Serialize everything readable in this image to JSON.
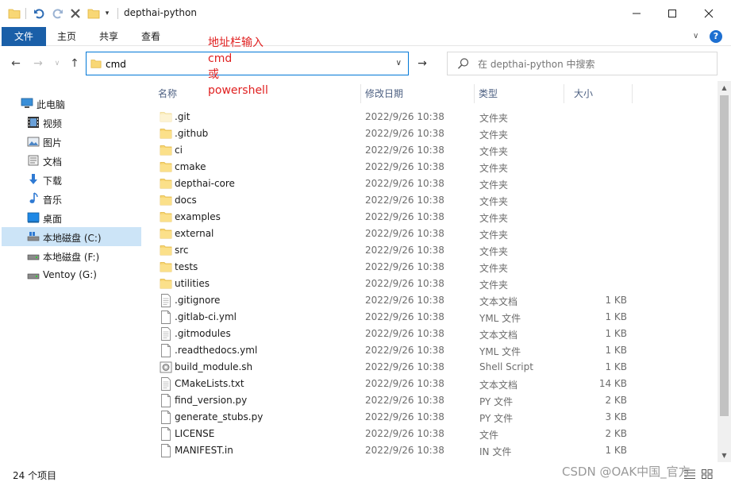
{
  "window": {
    "title": "depthai-python"
  },
  "ribbon": {
    "tabs": [
      "文件",
      "主页",
      "共享",
      "查看"
    ]
  },
  "address": {
    "value": "cmd"
  },
  "search": {
    "placeholder": "在 depthai-python 中搜索"
  },
  "annotation": {
    "lines": [
      "地址栏输入",
      "cmd",
      "或",
      "powershell"
    ]
  },
  "sidebar": {
    "items": [
      {
        "label": "此电脑",
        "icon": "computer-icon"
      },
      {
        "label": "视频",
        "icon": "video-icon"
      },
      {
        "label": "图片",
        "icon": "pictures-icon"
      },
      {
        "label": "文档",
        "icon": "documents-icon"
      },
      {
        "label": "下载",
        "icon": "download-icon"
      },
      {
        "label": "音乐",
        "icon": "music-icon"
      },
      {
        "label": "桌面",
        "icon": "desktop-icon"
      },
      {
        "label": "本地磁盘 (C:)",
        "icon": "drive-icon",
        "selected": true
      },
      {
        "label": "本地磁盘 (F:)",
        "icon": "drive-icon"
      },
      {
        "label": "Ventoy (G:)",
        "icon": "drive-icon"
      }
    ]
  },
  "columns": {
    "name": "名称",
    "date": "修改日期",
    "type": "类型",
    "size": "大小"
  },
  "files": [
    {
      "name": ".git",
      "date": "2022/9/26 10:38",
      "type": "文件夹",
      "size": "",
      "kind": "folder-faded"
    },
    {
      "name": ".github",
      "date": "2022/9/26 10:38",
      "type": "文件夹",
      "size": "",
      "kind": "folder"
    },
    {
      "name": "ci",
      "date": "2022/9/26 10:38",
      "type": "文件夹",
      "size": "",
      "kind": "folder"
    },
    {
      "name": "cmake",
      "date": "2022/9/26 10:38",
      "type": "文件夹",
      "size": "",
      "kind": "folder"
    },
    {
      "name": "depthai-core",
      "date": "2022/9/26 10:38",
      "type": "文件夹",
      "size": "",
      "kind": "folder"
    },
    {
      "name": "docs",
      "date": "2022/9/26 10:38",
      "type": "文件夹",
      "size": "",
      "kind": "folder"
    },
    {
      "name": "examples",
      "date": "2022/9/26 10:38",
      "type": "文件夹",
      "size": "",
      "kind": "folder"
    },
    {
      "name": "external",
      "date": "2022/9/26 10:38",
      "type": "文件夹",
      "size": "",
      "kind": "folder"
    },
    {
      "name": "src",
      "date": "2022/9/26 10:38",
      "type": "文件夹",
      "size": "",
      "kind": "folder"
    },
    {
      "name": "tests",
      "date": "2022/9/26 10:38",
      "type": "文件夹",
      "size": "",
      "kind": "folder"
    },
    {
      "name": "utilities",
      "date": "2022/9/26 10:38",
      "type": "文件夹",
      "size": "",
      "kind": "folder"
    },
    {
      "name": ".gitignore",
      "date": "2022/9/26 10:38",
      "type": "文本文档",
      "size": "1 KB",
      "kind": "text"
    },
    {
      "name": ".gitlab-ci.yml",
      "date": "2022/9/26 10:38",
      "type": "YML 文件",
      "size": "1 KB",
      "kind": "file"
    },
    {
      "name": ".gitmodules",
      "date": "2022/9/26 10:38",
      "type": "文本文档",
      "size": "1 KB",
      "kind": "text"
    },
    {
      "name": ".readthedocs.yml",
      "date": "2022/9/26 10:38",
      "type": "YML 文件",
      "size": "1 KB",
      "kind": "file"
    },
    {
      "name": "build_module.sh",
      "date": "2022/9/26 10:38",
      "type": "Shell Script",
      "size": "1 KB",
      "kind": "script"
    },
    {
      "name": "CMakeLists.txt",
      "date": "2022/9/26 10:38",
      "type": "文本文档",
      "size": "14 KB",
      "kind": "text"
    },
    {
      "name": "find_version.py",
      "date": "2022/9/26 10:38",
      "type": "PY 文件",
      "size": "2 KB",
      "kind": "file"
    },
    {
      "name": "generate_stubs.py",
      "date": "2022/9/26 10:38",
      "type": "PY 文件",
      "size": "3 KB",
      "kind": "file"
    },
    {
      "name": "LICENSE",
      "date": "2022/9/26 10:38",
      "type": "文件",
      "size": "2 KB",
      "kind": "file"
    },
    {
      "name": "MANIFEST.in",
      "date": "2022/9/26 10:38",
      "type": "IN 文件",
      "size": "1 KB",
      "kind": "file"
    }
  ],
  "status": {
    "count": "24 个项目"
  },
  "watermark": "CSDN @OAK中国_官方"
}
